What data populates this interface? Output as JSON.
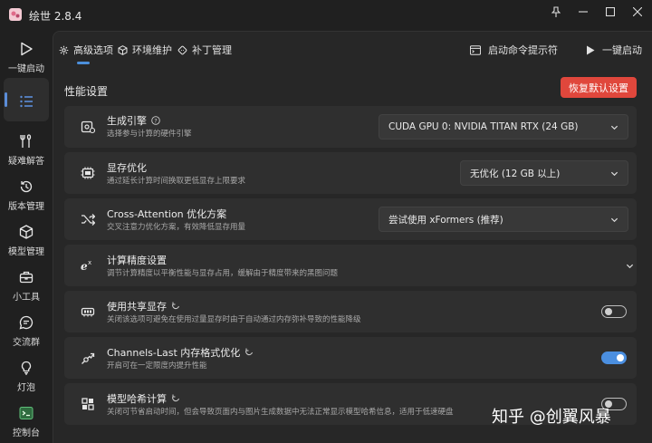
{
  "app": {
    "title": "绘世 2.8.4"
  },
  "window": {
    "pin_icon": "pin-icon",
    "minimize_icon": "minimize-icon",
    "maximize_icon": "maximize-icon",
    "close_icon": "close-icon"
  },
  "sidebar": {
    "items": [
      {
        "label": "一键启动",
        "icon": "play-icon"
      },
      {
        "label": "",
        "icon": "list-icon",
        "active": true
      },
      {
        "label": "疑难解答",
        "icon": "tools-icon"
      },
      {
        "label": "版本管理",
        "icon": "history-icon"
      },
      {
        "label": "模型管理",
        "icon": "cube-icon"
      },
      {
        "label": "小工具",
        "icon": "toolbox-icon"
      },
      {
        "label": "交流群",
        "icon": "chat-icon"
      },
      {
        "label": "灯泡",
        "icon": "bulb-icon"
      },
      {
        "label": "控制台",
        "icon": "console-icon"
      }
    ]
  },
  "tabs": [
    {
      "label": "高级选项",
      "icon": "gear-icon",
      "selected": true
    },
    {
      "label": "环境维护",
      "icon": "cube-icon"
    },
    {
      "label": "补丁管理",
      "icon": "patch-icon"
    }
  ],
  "actions": {
    "cmd_label": "启动命令提示符",
    "launch_label": "一键启动"
  },
  "section": {
    "title": "性能设置",
    "reset_label": "恢复默认设置"
  },
  "settings": [
    {
      "title": "生成引擎",
      "desc": "选择参与计算的硬件引擎",
      "value": "CUDA GPU 0: NVIDIA TITAN RTX (24 GB)",
      "icon": "gpu-icon"
    },
    {
      "title": "显存优化",
      "desc": "通过延长计算时间换取更低显存上限要求",
      "value": "无优化 (12 GB 以上)",
      "icon": "memory-icon"
    },
    {
      "title": "Cross-Attention 优化方案",
      "desc": "交叉注意力优化方案，有效降低显存用量",
      "value": "尝试使用 xFormers (推荐)",
      "icon": "shuffle-icon"
    },
    {
      "title": "计算精度设置",
      "desc": "调节计算精度以平衡性能与显存占用，缓解由于精度带来的黑图问题",
      "icon": "precision-icon"
    },
    {
      "title": "使用共享显存",
      "desc": "关闭该选项可避免在使用过量显存时由于自动通过内存弥补导致的性能降级",
      "toggle": false,
      "icon": "shared-memory-icon"
    },
    {
      "title": "Channels-Last 内存格式优化",
      "desc": "开启可在一定限度内提升性能",
      "toggle": true,
      "icon": "channels-icon"
    },
    {
      "title": "模型哈希计算",
      "desc": "关闭可节省启动时间，但会导致页面内与图片生成数据中无法正常显示模型哈希信息，适用于低速硬盘",
      "toggle": false,
      "icon": "hash-icon"
    }
  ],
  "watermark": "知乎 @创翼风暴",
  "colors": {
    "accent": "#4b8fe0",
    "danger": "#e0473c",
    "background": "#202020",
    "card": "#2f2f2f"
  }
}
